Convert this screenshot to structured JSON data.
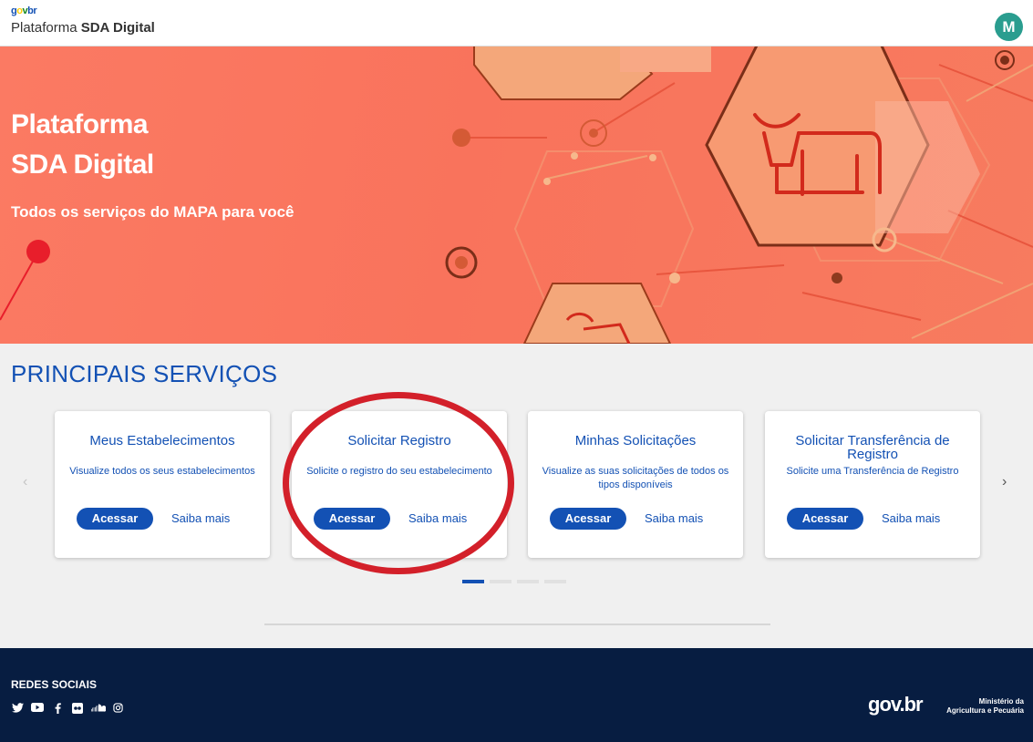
{
  "header": {
    "logo": {
      "g": "g",
      "o": "o",
      "v": "v",
      "br": "br"
    },
    "title_light": "Plataforma",
    "title_bold": "SDA Digital",
    "avatar_initial": "M"
  },
  "hero": {
    "title_line1": "Plataforma",
    "title_line2": "SDA Digital",
    "subtitle": "Todos os serviços do MAPA para você"
  },
  "services": {
    "section_title": "PRINCIPAIS SERVIÇOS",
    "arrow_left": "‹",
    "arrow_right": "›",
    "cards": [
      {
        "title": "Meus Estabelecimentos",
        "description": "Visualize todos os seus estabelecimentos",
        "access_label": "Acessar",
        "more_label": "Saiba mais"
      },
      {
        "title": "Solicitar Registro",
        "description": "Solicite o registro do seu estabelecimento",
        "access_label": "Acessar",
        "more_label": "Saiba mais"
      },
      {
        "title": "Minhas Solicitações",
        "description": "Visualize as suas solicitações de todos os tipos disponíveis",
        "access_label": "Acessar",
        "more_label": "Saiba mais"
      },
      {
        "title": "Solicitar Transferência de Registro",
        "description": "Solicite uma Transferência de Registro",
        "access_label": "Acessar",
        "more_label": "Saiba mais"
      }
    ]
  },
  "footer": {
    "social_title": "REDES SOCIAIS",
    "social_icons": [
      "twitter-icon",
      "youtube-icon",
      "facebook-icon",
      "flickr-icon",
      "soundcloud-icon",
      "instagram-icon"
    ],
    "govbr": "gov.br",
    "ministry_line1": "Ministério da",
    "ministry_line2": "Agricultura e Pecuária"
  },
  "colors": {
    "primary": "#1351b4",
    "hero": "#f9735c",
    "footer": "#071d41",
    "annotation": "#d3202a"
  }
}
